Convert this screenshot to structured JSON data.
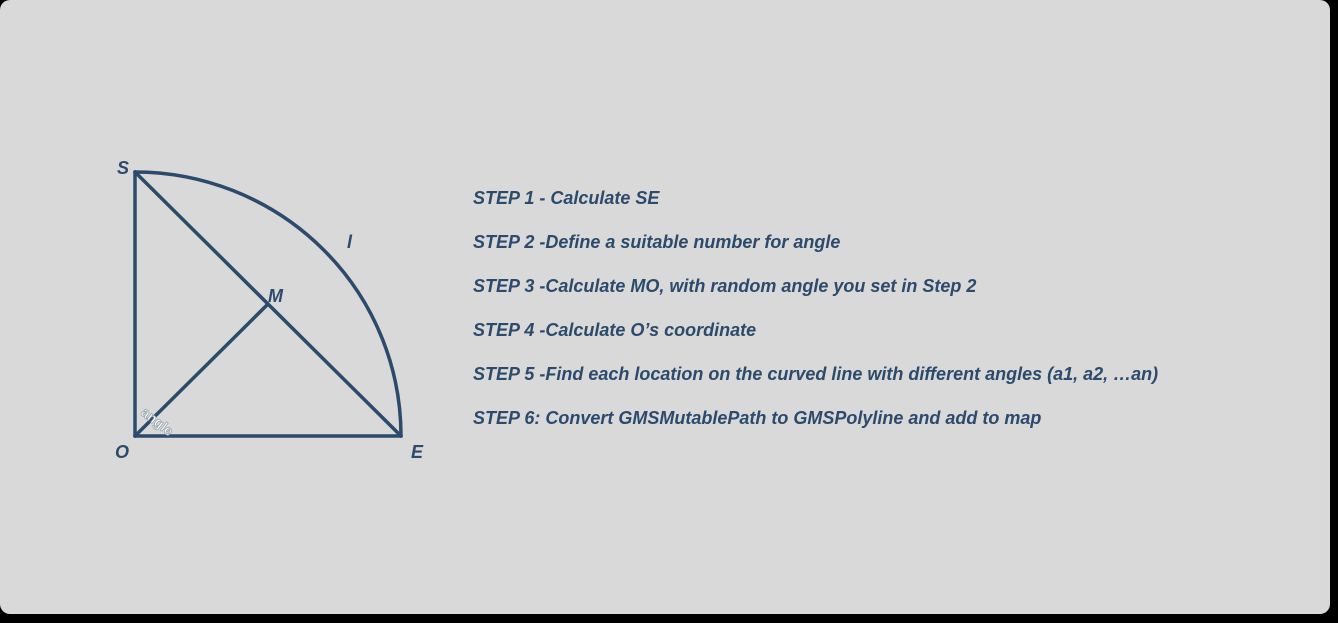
{
  "diagram": {
    "colors": {
      "line": "#2c4a6b",
      "background": "#d9d9d9"
    },
    "points": {
      "s": "S",
      "e": "E",
      "o": "O",
      "m": "M",
      "arc": "l"
    },
    "angle_label": "angle"
  },
  "steps": [
    "STEP 1 - Calculate SE",
    "STEP 2 -Define a suitable number for angle",
    "STEP 3 -Calculate MO, with random angle you set in Step 2",
    "STEP 4 -Calculate O’s coordinate",
    "STEP 5 -Find each location on the curved line with different angles (a1, a2, …an)",
    "STEP 6: Convert GMSMutablePath to GMSPolyline and add to map"
  ]
}
